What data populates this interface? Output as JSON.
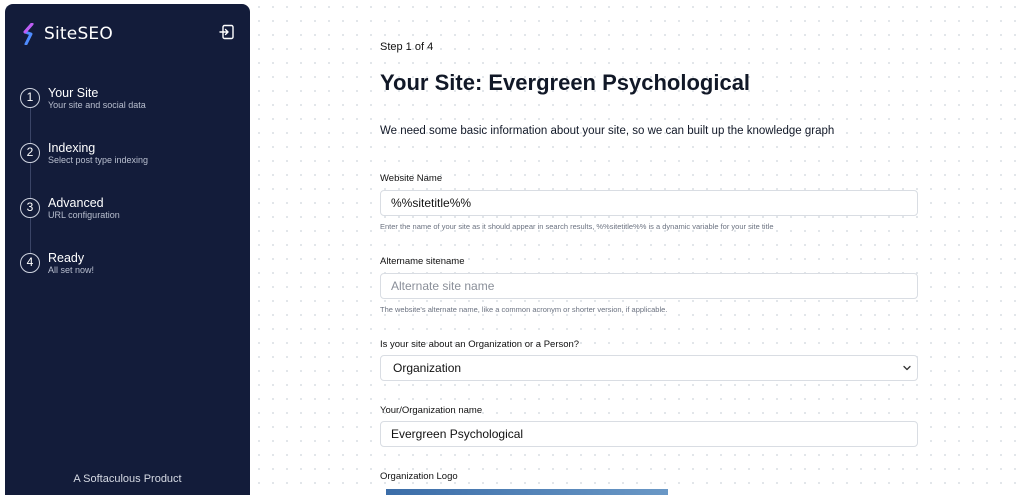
{
  "sidebar": {
    "brand": "SiteSEO",
    "steps": [
      {
        "num": "1",
        "title": "Your Site",
        "sub": "Your site and social data"
      },
      {
        "num": "2",
        "title": "Indexing",
        "sub": "Select post type indexing"
      },
      {
        "num": "3",
        "title": "Advanced",
        "sub": "URL configuration"
      },
      {
        "num": "4",
        "title": "Ready",
        "sub": "All set now!"
      }
    ],
    "footer": "A Softaculous Product"
  },
  "main": {
    "step_count": "Step 1 of 4",
    "title": "Your Site: Evergreen Psychological",
    "intro": "We need some basic information about your site, so we can built up the knowledge graph",
    "website_name": {
      "label": "Website Name",
      "value": "%%sitetitle%%",
      "help": "Enter the name of your site as it should appear in search results, %%sitetitle%% is a dynamic variable for your site title"
    },
    "alt_name": {
      "label": "Altername sitename",
      "placeholder": "Alternate site name",
      "help": "The website's alternate name, like a common acronym or shorter version, if applicable."
    },
    "site_type": {
      "label": "Is your site about an Organization or a Person?",
      "value": "Organization"
    },
    "org_name": {
      "label": "Your/Organization name",
      "value": "Evergreen Psychological"
    },
    "org_logo": {
      "label": "Organization Logo"
    }
  }
}
